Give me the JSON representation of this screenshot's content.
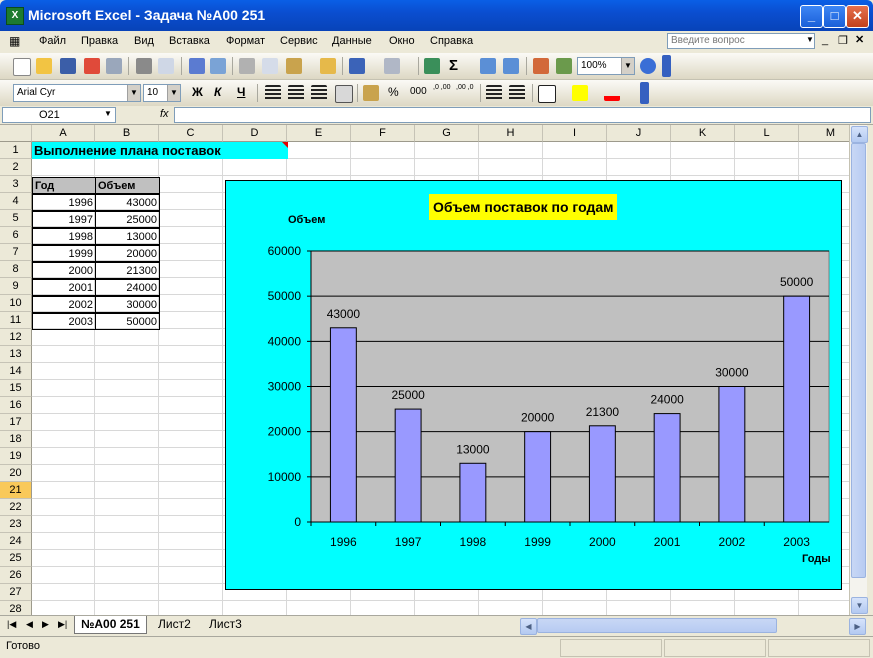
{
  "window": {
    "title": "Microsoft Excel - Задача №А00 251",
    "app_icon": "excel-icon"
  },
  "menu": {
    "items": [
      "Файл",
      "Правка",
      "Вид",
      "Вставка",
      "Формат",
      "Сервис",
      "Данные",
      "Окно",
      "Справка"
    ],
    "ask_placeholder": "Введите вопрос"
  },
  "toolbar": {
    "zoom": "100%",
    "font_name": "Arial Cyr",
    "font_size": "10",
    "bold": "Ж",
    "italic": "К",
    "underline": "Ч",
    "percent": "%",
    "thousands": "000",
    "inc_decimal": ",0 ,00",
    "dec_decimal": ",00 ,0",
    "sum": "Σ"
  },
  "formula_bar": {
    "name_box": "O21",
    "fx": "fx",
    "formula": ""
  },
  "sheet": {
    "columns": [
      "A",
      "B",
      "C",
      "D",
      "E",
      "F",
      "G",
      "H",
      "I",
      "J",
      "K",
      "L",
      "M"
    ],
    "rows": [
      "1",
      "2",
      "3",
      "4",
      "5",
      "6",
      "7",
      "8",
      "9",
      "10",
      "11",
      "12",
      "13",
      "14",
      "15",
      "16",
      "17",
      "18",
      "19",
      "20",
      "21",
      "22",
      "23",
      "24",
      "25",
      "26",
      "27",
      "28"
    ],
    "selected_row": "21",
    "a1_title": "Выполнение плана поставок",
    "table_header": {
      "year": "Год",
      "volume": "Объем"
    },
    "table_rows": [
      {
        "year": "1996",
        "volume": "43000"
      },
      {
        "year": "1997",
        "volume": "25000"
      },
      {
        "year": "1998",
        "volume": "13000"
      },
      {
        "year": "1999",
        "volume": "20000"
      },
      {
        "year": "2000",
        "volume": "21300"
      },
      {
        "year": "2001",
        "volume": "24000"
      },
      {
        "year": "2002",
        "volume": "30000"
      },
      {
        "year": "2003",
        "volume": "50000"
      }
    ]
  },
  "chart_data": {
    "type": "bar",
    "title": "Объем поставок по годам",
    "ylabel": "Объем",
    "xlabel": "Годы",
    "categories": [
      "1996",
      "1997",
      "1998",
      "1999",
      "2000",
      "2001",
      "2002",
      "2003"
    ],
    "values": [
      43000,
      25000,
      13000,
      20000,
      21300,
      24000,
      30000,
      50000
    ],
    "ylim": [
      0,
      60000
    ],
    "yticks": [
      0,
      10000,
      20000,
      30000,
      40000,
      50000,
      60000
    ],
    "grid": true,
    "legend": "none",
    "colors": {
      "bar": "#9999ff",
      "plot_bg": "#c0c0c0",
      "chart_bg": "#00ffff",
      "title_bg": "#ffff00"
    }
  },
  "tabs": {
    "items": [
      "№А00 251",
      "Лист2",
      "Лист3"
    ],
    "active": 0
  },
  "status": {
    "text": "Готово"
  },
  "colors": {
    "titlebar": "#0a4ed0",
    "selected_header": "#f9c95a",
    "chrome": "#ece9d8"
  }
}
